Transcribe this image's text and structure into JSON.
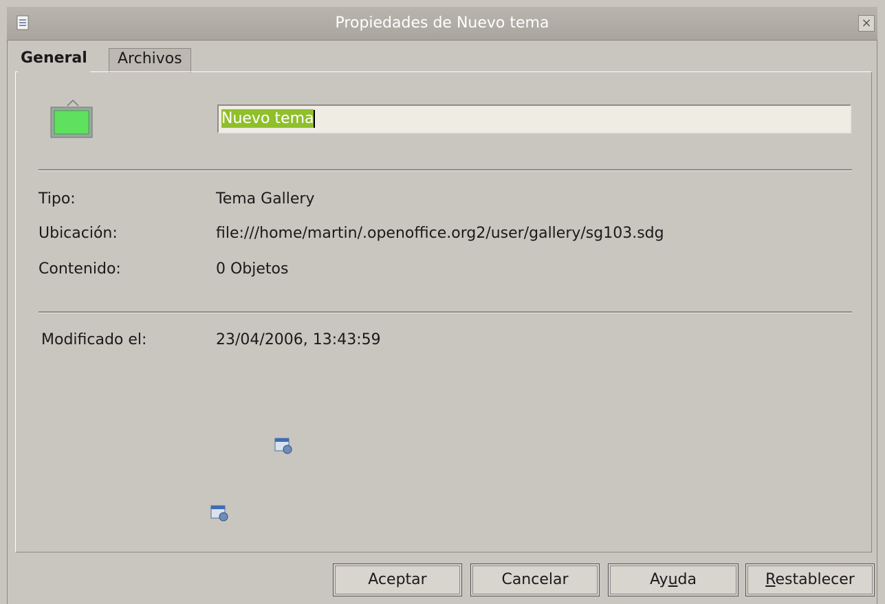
{
  "window": {
    "title": "Propiedades de Nuevo tema"
  },
  "tabs": [
    {
      "label": "General",
      "active": true
    },
    {
      "label": "Archivos",
      "active": false
    }
  ],
  "general": {
    "theme_name": "Nuevo tema",
    "fields": [
      {
        "label": "Tipo:",
        "value": "Tema Gallery"
      },
      {
        "label": "Ubicación:",
        "value": "file:///home/martin/.openoffice.org2/user/gallery/sg103.sdg"
      },
      {
        "label": "Contenido:",
        "value": "0 Objetos"
      }
    ],
    "modified": {
      "label": "Modificado el:",
      "value": "23/04/2006, 13:43:59"
    }
  },
  "buttons": {
    "ok": "Aceptar",
    "cancel": "Cancelar",
    "help_before": "Ay",
    "help_mnemonic": "u",
    "help_after": "da",
    "reset_mnemonic": "R",
    "reset_after": "establecer"
  },
  "colors": {
    "selection": "#8fbf2a",
    "dialog_bg": "#c9c5bf"
  },
  "icons": [
    "app-icon",
    "theme-gallery-icon",
    "close-icon",
    "small-window-icon"
  ]
}
